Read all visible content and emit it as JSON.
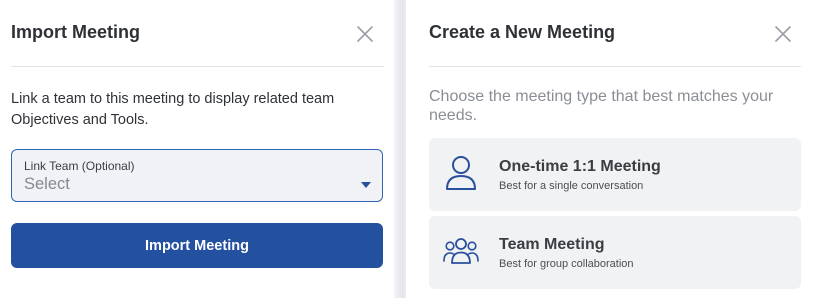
{
  "import_panel": {
    "title": "Import Meeting",
    "description": "Link a team to this meeting to display related team Objectives and Tools.",
    "link_team": {
      "label": "Link Team (Optional)",
      "value": "Select"
    },
    "import_button_label": "Import Meeting"
  },
  "create_panel": {
    "title": "Create a New Meeting",
    "description": "Choose the meeting type that best matches your needs.",
    "options": [
      {
        "icon": "person-icon",
        "title": "One-time 1:1 Meeting",
        "subtitle": "Best for a single conversation"
      },
      {
        "icon": "group-icon",
        "title": "Team Meeting",
        "subtitle": "Best for group collaboration"
      }
    ]
  },
  "colors": {
    "primary": "#2450a0",
    "focus_border": "#2f64b6",
    "icon_blue": "#2a4f9c"
  }
}
